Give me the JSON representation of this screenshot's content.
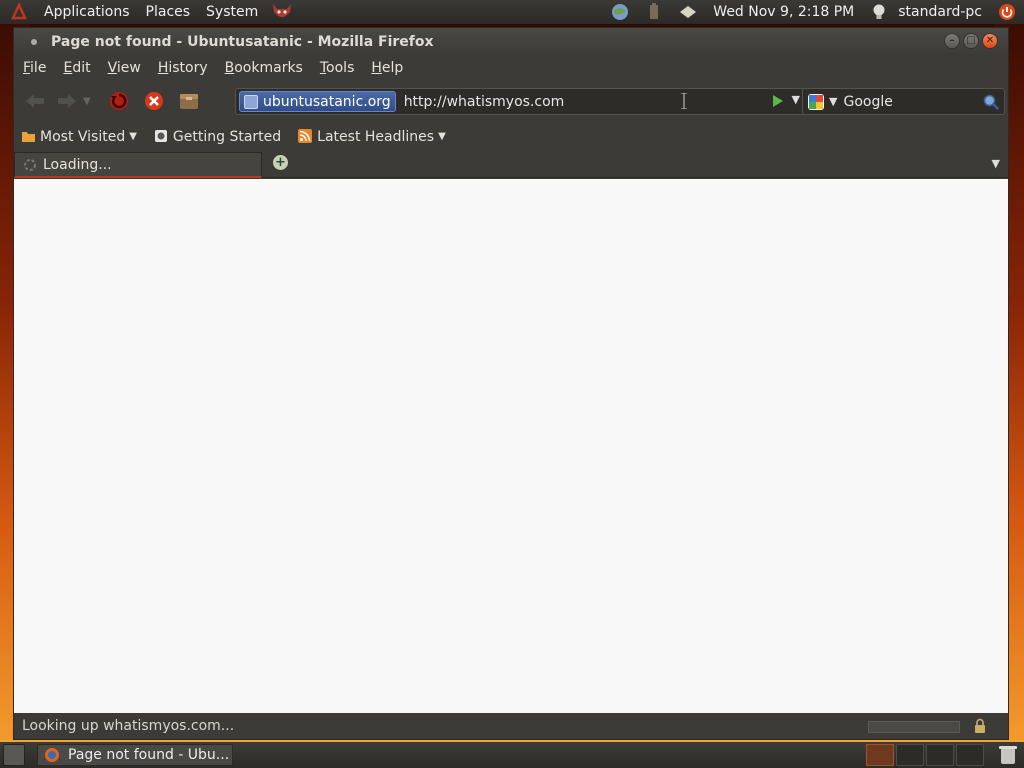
{
  "top_panel": {
    "menus": [
      "Applications",
      "Places",
      "System"
    ],
    "datetime": "Wed Nov 9,  2:18 PM",
    "username": "standard-pc"
  },
  "window": {
    "title": "Page not found - Ubuntusatanic - Mozilla Firefox"
  },
  "menubar": [
    "File",
    "Edit",
    "View",
    "History",
    "Bookmarks",
    "Tools",
    "Help"
  ],
  "urlbar": {
    "site_identity": "ubuntusatanic.org",
    "url": "http://whatismyos.com"
  },
  "searchbar": {
    "engine": "Google"
  },
  "bookmarks": [
    {
      "label": "Most Visited",
      "icon": "folder-icon",
      "has_menu": true
    },
    {
      "label": "Getting Started",
      "icon": "firefox-icon",
      "has_menu": false
    },
    {
      "label": "Latest Headlines",
      "icon": "rss-icon",
      "has_menu": true
    }
  ],
  "tabs": [
    {
      "label": "Loading...",
      "active": true
    }
  ],
  "statusbar": {
    "text": "Looking up whatismyos.com..."
  },
  "taskbar": {
    "task_label": "Page not found - Ubu..."
  },
  "colors": {
    "accent": "#dd4814",
    "panel": "#3c3b37",
    "content_bg": "#f8f8f8"
  }
}
